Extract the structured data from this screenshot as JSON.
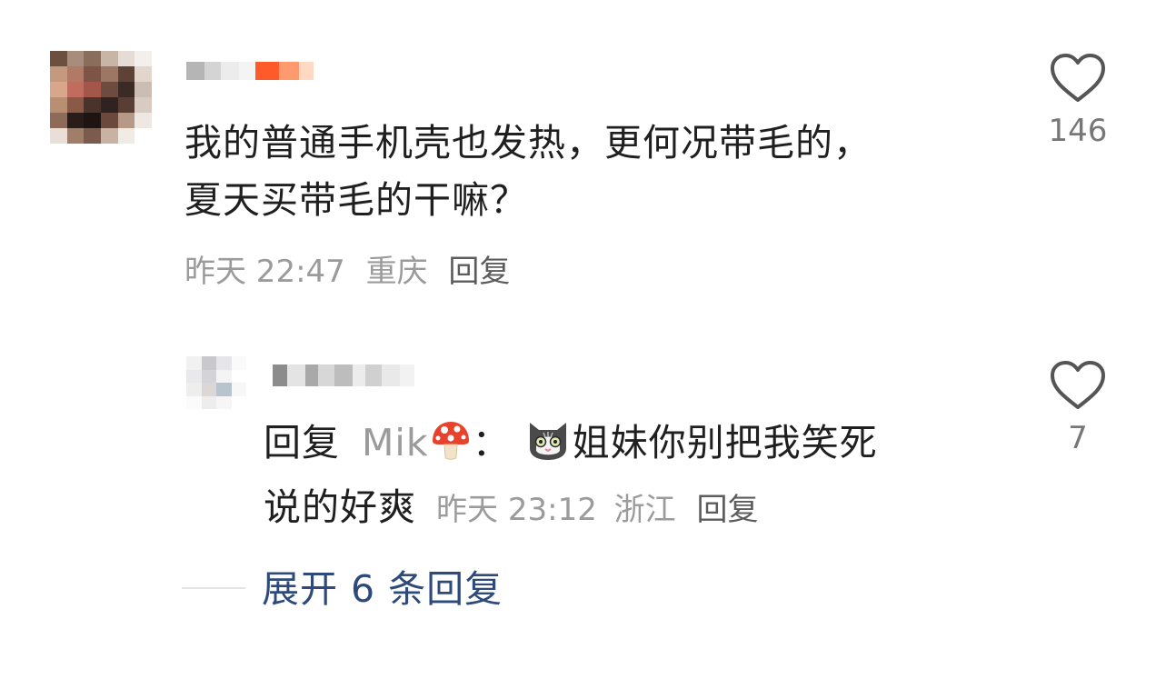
{
  "comment": {
    "text_line1": "我的普通手机壳也发热，更何况带毛的，",
    "text_line2": "夏天买带毛的干嘛？",
    "time": "昨天 22:47",
    "location": "重庆",
    "reply_label": "回复",
    "like_count": "146",
    "avatar_colors": [
      "#6b4f3f",
      "#a88d7c",
      "#8a6e5c",
      "#c9b5a6",
      "#e6dcd5",
      "#f3efec",
      "#c49a7e",
      "#b07a66",
      "#7d5446",
      "#9d7765",
      "#5e4238",
      "#e1d5cc",
      "#d8a78b",
      "#c06c5f",
      "#a5564b",
      "#6d4b3e",
      "#3a2b26",
      "#cbbdb3",
      "#b98f74",
      "#8a5a47",
      "#4a332b",
      "#2f2220",
      "#5a3d34",
      "#d9cbc1",
      "#8f6a58",
      "#2a1c19",
      "#1e1412",
      "#6b4a3d",
      "#b69a87",
      "#efe7e1",
      "#e9dfd8",
      "#a07e6a",
      "#7a5b4c",
      "#c8b2a3",
      "#f1ebe6",
      "#ffffff"
    ],
    "name_colors": [
      "#b5b5b5",
      "#d4d4d4",
      "#ececec",
      "#f4f4f4",
      "#ff5a2a",
      "#ff9a6e",
      "#ffd9c4"
    ]
  },
  "reply": {
    "prefix": "回复",
    "mention": "Mik",
    "separator": "：",
    "text_line1": "姐妹你别把我笑死",
    "text_line2": "说的好爽",
    "time": "昨天 23:12",
    "location": "浙江",
    "reply_label": "回复",
    "like_count": "7",
    "avatar_colors": [
      "#f1f1f1",
      "#c9c9cc",
      "#e6e6ea",
      "#fafafa",
      "#e9e9ec",
      "#d3d3d8",
      "#f4f4f4",
      "#ffffff",
      "#eeeeee",
      "#ddd6d6",
      "#b7c4cf",
      "#f7f7f7",
      "#fbfbfb",
      "#ededed",
      "#f6f6f6",
      "#ffffff"
    ],
    "name_colors": [
      "#8c8c8c",
      "#e4e4e4",
      "#a9a9a9",
      "#d7d7d7",
      "#bdbdbd",
      "#ececec",
      "#d0d0d0",
      "#e9e9e9",
      "#f2f2f2"
    ]
  },
  "expand": {
    "label": "展开 6 条回复"
  },
  "icons": {
    "like": "heart-outline-icon",
    "mushroom": "mushroom-emoji",
    "cat": "cat-face-emoji"
  },
  "colors": {
    "expand_link": "#2d4a7a",
    "meta_text": "#9b9b9b",
    "reply_link": "#5c5c5c"
  }
}
